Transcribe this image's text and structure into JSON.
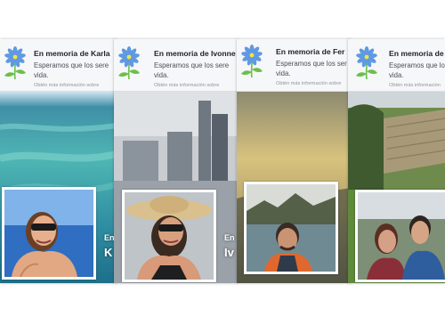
{
  "cards": [
    {
      "title": "En memoria de Karla",
      "message_line1": "Esperamos que los sere",
      "message_line2": "vida.",
      "more_info": "Obtén más información sobre",
      "name_fragment_small": "En",
      "name_fragment_big": "K"
    },
    {
      "title": "En memoria de Ivonne",
      "message_line1": "Esperamos que los sere",
      "message_line2": "vida.",
      "more_info": "Obtén más información sobre",
      "name_fragment_small": "En",
      "name_fragment_big": "Iv"
    },
    {
      "title": "En memoria de Fer",
      "message_line1": "Esperamos que los ser",
      "message_line2": "vida.",
      "more_info": "Obtén más información sobre"
    },
    {
      "title": "En memoria de",
      "message_line1": "Esperamos que los",
      "message_line2": "vida.",
      "more_info": "Obtén más información"
    }
  ],
  "colors": {
    "flower_petal": "#4f8fe0",
    "flower_leaf": "#6cbf4b",
    "header_bg": "#f6f7f9"
  },
  "icons": [
    "memorial-flower-icon"
  ]
}
